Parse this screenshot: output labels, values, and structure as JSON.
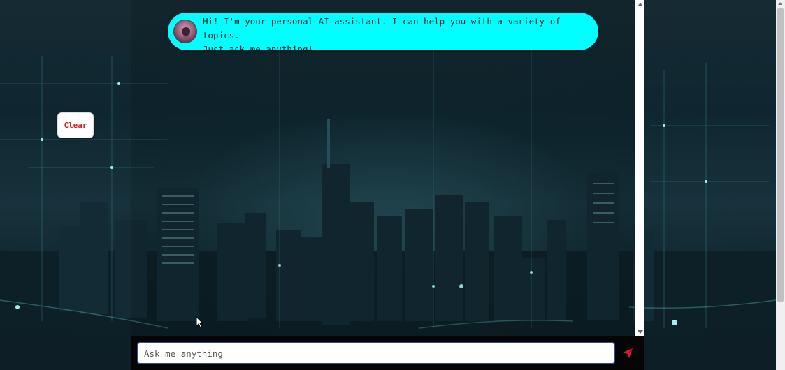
{
  "background": {
    "description_icon": "city-skyline-background"
  },
  "chat": {
    "messages": [
      {
        "sender": "assistant",
        "avatar_icon": "robot-avatar-icon",
        "line1": "Hi! I'm your personal AI assistant. I can help you with a variety of topics.",
        "line2": "Just ask me anything!"
      }
    ]
  },
  "controls": {
    "clear_label": "Clear"
  },
  "composer": {
    "placeholder": "Ask me anything",
    "value": "",
    "send_icon": "send-icon"
  },
  "colors": {
    "bubble": "#00ffff",
    "clear_text": "#d42020",
    "send": "#e02030",
    "input_border": "#3a4a9a"
  }
}
